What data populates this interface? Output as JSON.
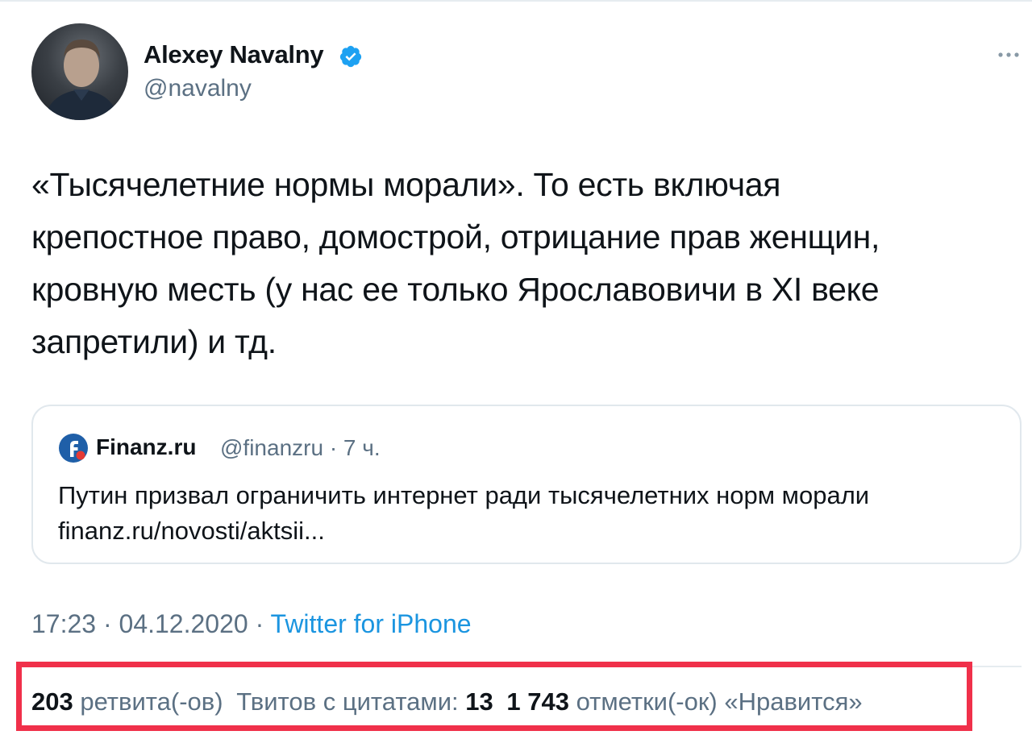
{
  "author": {
    "display_name": "Alexey Navalny",
    "handle": "@navalny",
    "verified": true
  },
  "tweet": {
    "lines": [
      "«Тысячелетние нормы морали». То есть включая",
      "крепостное право, домострой, отрицание прав женщин,",
      "кровную месть (у нас ее только Ярославовичи в  XI веке",
      "запретили) и тд."
    ]
  },
  "quote": {
    "name": "Finanz.ru",
    "meta": "@finanzru · 7 ч.",
    "lines": [
      "Путин призвал ограничить интернет ради тысячелетних норм морали",
      "finanz.ru/novosti/aktsii..."
    ]
  },
  "meta": {
    "time_date": "17:23 · 04.12.2020 · ",
    "source": "Twitter for iPhone"
  },
  "stats": {
    "retweets_count": "203",
    "retweets_label": "ретвита(-ов)",
    "quotes_label": "Твитов с цитатами:",
    "quotes_count": "13",
    "likes_count": "1 743",
    "likes_label": "отметки(-ок) «Нравится»"
  },
  "colors": {
    "accent": "#1b95e0",
    "verified": "#1da1f2",
    "highlight": "#f0304a",
    "secondary_text": "#5b7083"
  },
  "icons": {
    "verified": "verified-badge-icon",
    "more": "more-options-icon",
    "quote_logo": "finanz-logo-icon"
  }
}
